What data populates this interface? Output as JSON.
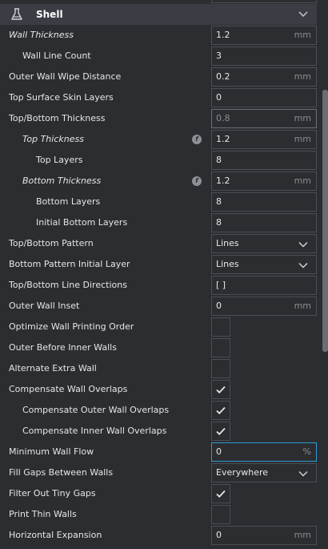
{
  "section": {
    "title": "Shell",
    "icon": "shell-icon"
  },
  "settings": [
    {
      "label": "Wall Thickness",
      "value": "1.2",
      "unit": "mm"
    },
    {
      "label": "Wall Line Count",
      "value": "3",
      "unit": ""
    },
    {
      "label": "Outer Wall Wipe Distance",
      "value": "0.2",
      "unit": "mm"
    },
    {
      "label": "Top Surface Skin Layers",
      "value": "0",
      "unit": ""
    },
    {
      "label": "Top/Bottom Thickness",
      "value": "0.8",
      "unit": "mm"
    },
    {
      "label": "Top Thickness",
      "value": "1.2",
      "unit": "mm"
    },
    {
      "label": "Top Layers",
      "value": "8",
      "unit": ""
    },
    {
      "label": "Bottom Thickness",
      "value": "1.2",
      "unit": "mm"
    },
    {
      "label": "Bottom Layers",
      "value": "8",
      "unit": ""
    },
    {
      "label": "Initial Bottom Layers",
      "value": "8",
      "unit": ""
    },
    {
      "label": "Top/Bottom Pattern",
      "value": "Lines"
    },
    {
      "label": "Bottom Pattern Initial Layer",
      "value": "Lines"
    },
    {
      "label": "Top/Bottom Line Directions",
      "value": "[ ]",
      "unit": ""
    },
    {
      "label": "Outer Wall Inset",
      "value": "0",
      "unit": "mm"
    },
    {
      "label": "Optimize Wall Printing Order",
      "checked": false
    },
    {
      "label": "Outer Before Inner Walls",
      "checked": false
    },
    {
      "label": "Alternate Extra Wall",
      "checked": false
    },
    {
      "label": "Compensate Wall Overlaps",
      "checked": true
    },
    {
      "label": "Compensate Outer Wall Overlaps",
      "checked": true
    },
    {
      "label": "Compensate Inner Wall Overlaps",
      "checked": true
    },
    {
      "label": "Minimum Wall Flow",
      "value": "0",
      "unit": "%"
    },
    {
      "label": "Fill Gaps Between Walls",
      "value": "Everywhere"
    },
    {
      "label": "Filter Out Tiny Gaps",
      "checked": true
    },
    {
      "label": "Print Thin Walls",
      "checked": false
    },
    {
      "label": "Horizontal Expansion",
      "value": "0",
      "unit": "mm"
    }
  ],
  "colors": {
    "background": "#2b2d31",
    "header": "#3a3d43",
    "border": "#4a4d53",
    "focus": "#2d9bd6",
    "scrollbar": "#6a6d73"
  }
}
